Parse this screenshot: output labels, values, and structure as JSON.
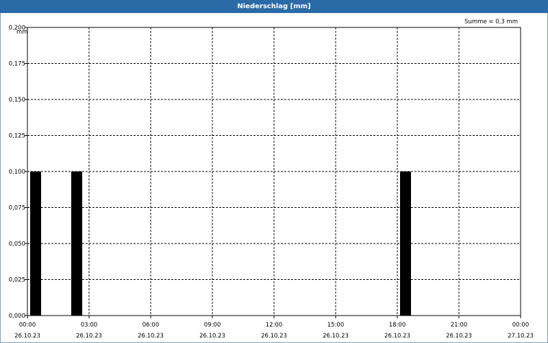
{
  "chart_data": {
    "type": "bar",
    "title": "Niederschlag [mm]",
    "ylabel": "mm",
    "summary": "Summe = 0,3 mm",
    "ylim": [
      0,
      0.2
    ],
    "y_ticks": [
      "0,000",
      "0,025",
      "0,050",
      "0,075",
      "0,100",
      "0,125",
      "0,150",
      "0,175",
      "0,200"
    ],
    "x_range_hours": [
      0,
      24
    ],
    "x_ticks": [
      {
        "time": "00:00",
        "date": "26.10.23"
      },
      {
        "time": "03:00",
        "date": "26.10.23"
      },
      {
        "time": "06:00",
        "date": "26.10.23"
      },
      {
        "time": "09:00",
        "date": "26.10.23"
      },
      {
        "time": "12:00",
        "date": "26.10.23"
      },
      {
        "time": "15:00",
        "date": "26.10.23"
      },
      {
        "time": "18:00",
        "date": "26.10.23"
      },
      {
        "time": "21:00",
        "date": "26.10.23"
      },
      {
        "time": "00:00",
        "date": "27.10.23"
      }
    ],
    "bars": [
      {
        "start": "00:00",
        "end": "00:40",
        "value": 0.1
      },
      {
        "start": "02:00",
        "end": "02:40",
        "value": 0.1
      },
      {
        "start": "18:00",
        "end": "18:40",
        "value": 0.1
      }
    ],
    "grid": true,
    "colors": {
      "bar": "#000000",
      "title_bar": "#2a6aa6",
      "grid": "#000000"
    }
  }
}
